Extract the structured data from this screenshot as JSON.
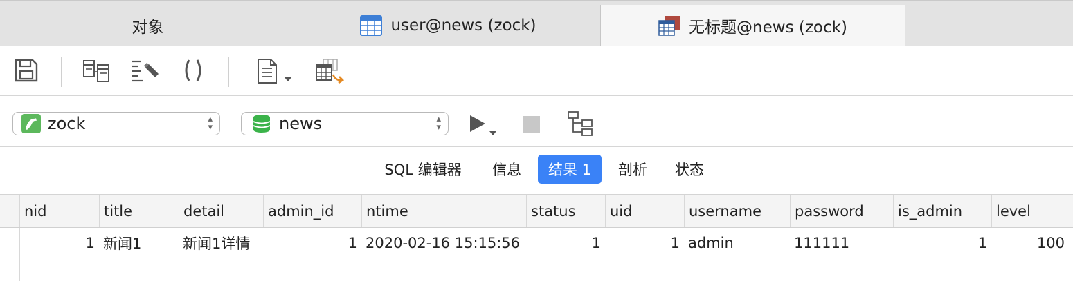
{
  "tabs": [
    {
      "label": "对象",
      "icon": null
    },
    {
      "label": "user@news (zock)",
      "icon": "table-icon"
    },
    {
      "label": "无标题@news (zock)",
      "icon": "query-icon"
    }
  ],
  "toolbar": {
    "icons": [
      "save-icon",
      "query-builder-icon",
      "beautify-sql-icon",
      "code-snippet-icon",
      "text-file-icon",
      "export-result-icon"
    ]
  },
  "connection": {
    "value": "zock",
    "icon": "connection-icon"
  },
  "database": {
    "value": "news",
    "icon": "database-icon"
  },
  "segments": [
    {
      "label": "SQL 编辑器"
    },
    {
      "label": "信息"
    },
    {
      "label": "结果 1"
    },
    {
      "label": "剖析"
    },
    {
      "label": "状态"
    }
  ],
  "accent_color": "#3a82f7",
  "grid": {
    "columns": [
      "nid",
      "title",
      "detail",
      "admin_id",
      "ntime",
      "status",
      "uid",
      "username",
      "password",
      "is_admin",
      "level"
    ],
    "rows": [
      [
        "1",
        "新闻1",
        "新闻1详情",
        "1",
        "2020-02-16 15:15:56",
        "1",
        "1",
        "admin",
        "111111",
        "1",
        "100"
      ]
    ]
  }
}
